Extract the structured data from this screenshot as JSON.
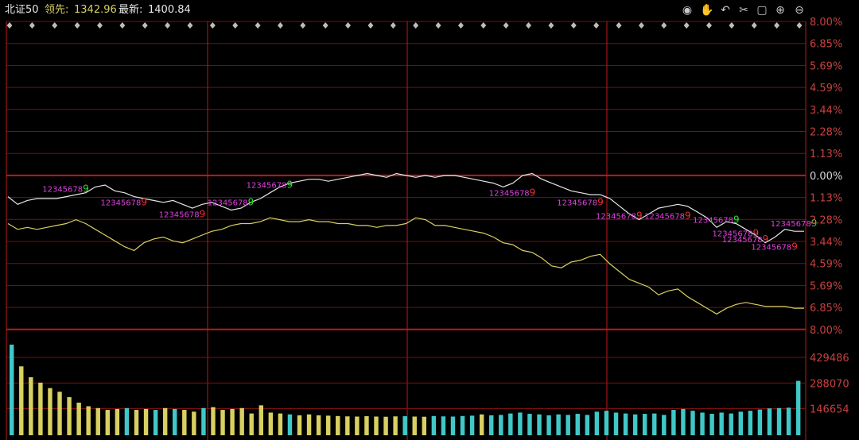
{
  "header": {
    "title": "北证50",
    "lead_label": "领先:",
    "lead_value": "1342.96",
    "latest_label": "最新:",
    "latest_value": "1400.84"
  },
  "toolbar_icons": [
    "eye-icon",
    "hand-icon",
    "undo-icon",
    "scissors-icon",
    "lock-icon",
    "zoom-in-icon",
    "zoom-out-icon"
  ],
  "colors": {
    "background": "#000000",
    "grid": "#7a1010",
    "grid_strong": "#c01818",
    "white_line": "#e6e6e6",
    "yellow_line": "#d8d060",
    "axis_text": "#c84040",
    "zero_text": "#d8d8d8",
    "volume_yellow": "#d8d060",
    "volume_cyan": "#40c8c8",
    "td_magenta": "#e040e0",
    "td_green": "#30e030",
    "td_red": "#f03030",
    "diamond": "#bdbdbd"
  },
  "chart_data": {
    "type": "line",
    "title": "北证50",
    "series": [
      {
        "name": "最新",
        "values": [
          1.1,
          1.5,
          1.3,
          1.2,
          1.2,
          1.2,
          1.1,
          1.0,
          0.9,
          0.6,
          0.5,
          0.8,
          0.9,
          1.1,
          1.2,
          1.3,
          1.4,
          1.3,
          1.5,
          1.7,
          1.5,
          1.4,
          1.6,
          1.8,
          1.7,
          1.4,
          1.2,
          0.9,
          0.6,
          0.4,
          0.3,
          0.2,
          0.2,
          0.3,
          0.2,
          0.1,
          0.0,
          -0.1,
          0.0,
          0.1,
          -0.1,
          0.0,
          0.1,
          0.0,
          0.1,
          0.0,
          0.0,
          0.1,
          0.2,
          0.3,
          0.4,
          0.6,
          0.4,
          0.0,
          -0.1,
          0.2,
          0.4,
          0.6,
          0.8,
          0.9,
          1.0,
          1.0,
          1.2,
          1.6,
          2.0,
          2.3,
          2.0,
          1.7,
          1.6,
          1.5,
          1.6,
          1.9,
          2.2,
          2.7,
          2.4,
          2.5,
          2.8,
          3.1,
          3.5,
          3.2,
          2.8,
          2.9,
          2.9
        ]
      },
      {
        "name": "领先",
        "values": [
          2.5,
          2.8,
          2.7,
          2.8,
          2.7,
          2.6,
          2.5,
          2.3,
          2.5,
          2.8,
          3.1,
          3.4,
          3.7,
          3.9,
          3.5,
          3.3,
          3.2,
          3.4,
          3.5,
          3.3,
          3.1,
          2.9,
          2.8,
          2.6,
          2.5,
          2.5,
          2.4,
          2.2,
          2.3,
          2.4,
          2.4,
          2.3,
          2.4,
          2.4,
          2.5,
          2.5,
          2.6,
          2.6,
          2.7,
          2.6,
          2.6,
          2.5,
          2.2,
          2.3,
          2.6,
          2.6,
          2.7,
          2.8,
          2.9,
          3.0,
          3.2,
          3.5,
          3.6,
          3.9,
          4.0,
          4.3,
          4.7,
          4.8,
          4.5,
          4.4,
          4.2,
          4.1,
          4.6,
          5.0,
          5.4,
          5.6,
          5.8,
          6.2,
          6.0,
          5.9,
          6.3,
          6.6,
          6.9,
          7.2,
          6.9,
          6.7,
          6.6,
          6.7,
          6.8,
          6.8,
          6.8,
          6.9,
          6.9
        ]
      }
    ],
    "y_ticks": [
      "8.00%",
      "6.85%",
      "5.69%",
      "4.59%",
      "3.44%",
      "2.28%",
      "1.13%",
      "0.00%",
      "1.13%",
      "2.28%",
      "3.44%",
      "4.59%",
      "5.69%",
      "6.85%",
      "8.00%"
    ],
    "y_tick_values": [
      8.0,
      6.85,
      5.69,
      4.59,
      3.44,
      2.28,
      1.13,
      0.0,
      -1.13,
      -2.28,
      -3.44,
      -4.59,
      -5.69,
      -6.85,
      -8.0
    ],
    "ylim": [
      -8.0,
      8.0
    ],
    "grid": true,
    "volume": {
      "y_ticks": [
        "429486",
        "288070",
        "146654"
      ],
      "bars": [
        {
          "v": 500000,
          "c": "cyan"
        },
        {
          "v": 380000,
          "c": "yellow"
        },
        {
          "v": 320000,
          "c": "yellow"
        },
        {
          "v": 290000,
          "c": "yellow"
        },
        {
          "v": 260000,
          "c": "yellow"
        },
        {
          "v": 240000,
          "c": "yellow"
        },
        {
          "v": 210000,
          "c": "yellow"
        },
        {
          "v": 180000,
          "c": "yellow"
        },
        {
          "v": 160000,
          "c": "yellow"
        },
        {
          "v": 150000,
          "c": "yellow"
        },
        {
          "v": 140000,
          "c": "yellow"
        },
        {
          "v": 145000,
          "c": "yellow"
        },
        {
          "v": 150000,
          "c": "cyan"
        },
        {
          "v": 140000,
          "c": "yellow"
        },
        {
          "v": 145000,
          "c": "yellow"
        },
        {
          "v": 140000,
          "c": "cyan"
        },
        {
          "v": 150000,
          "c": "yellow"
        },
        {
          "v": 145000,
          "c": "cyan"
        },
        {
          "v": 140000,
          "c": "yellow"
        },
        {
          "v": 130000,
          "c": "yellow"
        },
        {
          "v": 150000,
          "c": "cyan"
        },
        {
          "v": 155000,
          "c": "yellow"
        },
        {
          "v": 140000,
          "c": "yellow"
        },
        {
          "v": 145000,
          "c": "yellow"
        },
        {
          "v": 150000,
          "c": "yellow"
        },
        {
          "v": 120000,
          "c": "yellow"
        },
        {
          "v": 165000,
          "c": "yellow"
        },
        {
          "v": 125000,
          "c": "yellow"
        },
        {
          "v": 120000,
          "c": "yellow"
        },
        {
          "v": 115000,
          "c": "cyan"
        },
        {
          "v": 110000,
          "c": "yellow"
        },
        {
          "v": 115000,
          "c": "yellow"
        },
        {
          "v": 110000,
          "c": "yellow"
        },
        {
          "v": 108000,
          "c": "yellow"
        },
        {
          "v": 106000,
          "c": "yellow"
        },
        {
          "v": 104000,
          "c": "yellow"
        },
        {
          "v": 103000,
          "c": "yellow"
        },
        {
          "v": 105000,
          "c": "yellow"
        },
        {
          "v": 103000,
          "c": "yellow"
        },
        {
          "v": 102000,
          "c": "yellow"
        },
        {
          "v": 104000,
          "c": "yellow"
        },
        {
          "v": 105000,
          "c": "cyan"
        },
        {
          "v": 103000,
          "c": "yellow"
        },
        {
          "v": 102000,
          "c": "yellow"
        },
        {
          "v": 106000,
          "c": "cyan"
        },
        {
          "v": 104000,
          "c": "cyan"
        },
        {
          "v": 103000,
          "c": "cyan"
        },
        {
          "v": 106000,
          "c": "cyan"
        },
        {
          "v": 108000,
          "c": "cyan"
        },
        {
          "v": 115000,
          "c": "yellow"
        },
        {
          "v": 110000,
          "c": "cyan"
        },
        {
          "v": 112000,
          "c": "cyan"
        },
        {
          "v": 120000,
          "c": "cyan"
        },
        {
          "v": 125000,
          "c": "cyan"
        },
        {
          "v": 118000,
          "c": "cyan"
        },
        {
          "v": 115000,
          "c": "cyan"
        },
        {
          "v": 110000,
          "c": "cyan"
        },
        {
          "v": 115000,
          "c": "cyan"
        },
        {
          "v": 112000,
          "c": "cyan"
        },
        {
          "v": 118000,
          "c": "cyan"
        },
        {
          "v": 112000,
          "c": "cyan"
        },
        {
          "v": 130000,
          "c": "cyan"
        },
        {
          "v": 135000,
          "c": "cyan"
        },
        {
          "v": 125000,
          "c": "cyan"
        },
        {
          "v": 120000,
          "c": "cyan"
        },
        {
          "v": 115000,
          "c": "cyan"
        },
        {
          "v": 118000,
          "c": "cyan"
        },
        {
          "v": 120000,
          "c": "cyan"
        },
        {
          "v": 112000,
          "c": "cyan"
        },
        {
          "v": 140000,
          "c": "cyan"
        },
        {
          "v": 145000,
          "c": "cyan"
        },
        {
          "v": 135000,
          "c": "cyan"
        },
        {
          "v": 125000,
          "c": "cyan"
        },
        {
          "v": 118000,
          "c": "cyan"
        },
        {
          "v": 125000,
          "c": "cyan"
        },
        {
          "v": 120000,
          "c": "cyan"
        },
        {
          "v": 130000,
          "c": "cyan"
        },
        {
          "v": 135000,
          "c": "cyan"
        },
        {
          "v": 142000,
          "c": "cyan"
        },
        {
          "v": 148000,
          "c": "cyan"
        },
        {
          "v": 150000,
          "c": "cyan"
        },
        {
          "v": 152000,
          "c": "cyan"
        },
        {
          "v": 300000,
          "c": "cyan"
        }
      ]
    },
    "td_sequences": [
      {
        "digits": "12345678",
        "end": "9",
        "end_color": "green",
        "i": 0
      },
      {
        "digits": "12345678",
        "end": "9",
        "end_color": "red",
        "i": 1
      },
      {
        "digits": "12345678",
        "end": "9",
        "end_color": "red",
        "i": 2
      },
      {
        "digits": "12345678",
        "end": "9",
        "end_color": "green",
        "i": 3
      },
      {
        "digits": "12345678",
        "end": "9",
        "end_color": "green",
        "i": 4
      },
      {
        "digits": "12345678",
        "end": "9",
        "end_color": "red",
        "i": 5
      },
      {
        "digits": "12345678",
        "end": "9",
        "end_color": "red",
        "i": 6
      },
      {
        "digits": "12345678",
        "end": "9",
        "end_color": "red",
        "i": 7
      },
      {
        "digits": "12345678",
        "end": "9",
        "end_color": "red",
        "i": 8
      },
      {
        "digits": "12345678",
        "end": "9",
        "end_color": "green",
        "i": 9
      },
      {
        "digits": "12345678",
        "end": "9",
        "end_color": "red",
        "i": 10
      },
      {
        "digits": "12345678",
        "end": "9",
        "end_color": "red",
        "i": 11
      },
      {
        "digits": "12345678",
        "end": "9",
        "end_color": "red",
        "i": 12
      },
      {
        "digits": "12345678",
        "end": "9",
        "end_color": "green",
        "i": 13
      }
    ],
    "diamond_count": 36
  }
}
